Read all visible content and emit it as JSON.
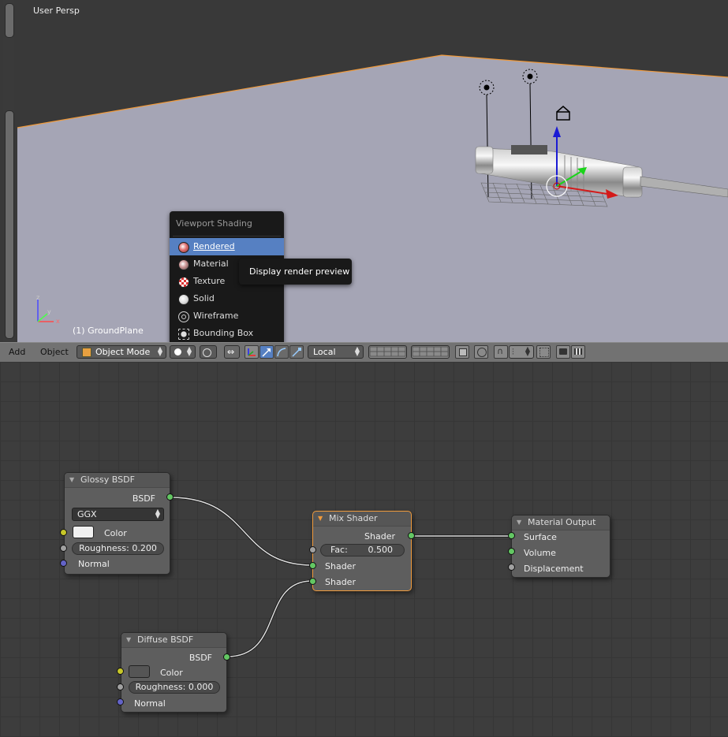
{
  "viewport": {
    "title": "User Persp",
    "object_label": "(1) GroundPlane",
    "colors": {
      "background": "#393939",
      "ground": "#a5a5b5",
      "selected_edge": "#f09a3b"
    }
  },
  "shading_menu": {
    "title": "Viewport Shading",
    "items": [
      {
        "label": "Rendered",
        "icon": "rendered-sphere-icon",
        "active": true
      },
      {
        "label": "Material",
        "icon": "material-sphere-icon",
        "active": false
      },
      {
        "label": "Texture",
        "icon": "texture-sphere-icon",
        "active": false
      },
      {
        "label": "Solid",
        "icon": "solid-sphere-icon",
        "active": false
      },
      {
        "label": "Wireframe",
        "icon": "wireframe-sphere-icon",
        "active": false
      },
      {
        "label": "Bounding Box",
        "icon": "bounding-box-icon",
        "active": false
      }
    ],
    "tooltip": "Display render preview"
  },
  "header": {
    "add_menu": "Add",
    "object_menu": "Object",
    "mode": "Object Mode",
    "pivot": "Local"
  },
  "nodes": {
    "glossy": {
      "title": "Glossy BSDF",
      "output": "BSDF",
      "distribution": "GGX",
      "color_label": "Color",
      "roughness": "Roughness:  0.200",
      "normal_label": "Normal",
      "color_value": "#f0f0f0"
    },
    "diffuse": {
      "title": "Diffuse BSDF",
      "output": "BSDF",
      "color_label": "Color",
      "roughness": "Roughness:  0.000",
      "normal_label": "Normal",
      "color_value": "#555555"
    },
    "mix": {
      "title": "Mix Shader",
      "output": "Shader",
      "fac_label": "Fac:",
      "fac_value": "0.500",
      "input1": "Shader",
      "input2": "Shader"
    },
    "output": {
      "title": "Material Output",
      "surface": "Surface",
      "volume": "Volume",
      "displacement": "Displacement"
    }
  }
}
